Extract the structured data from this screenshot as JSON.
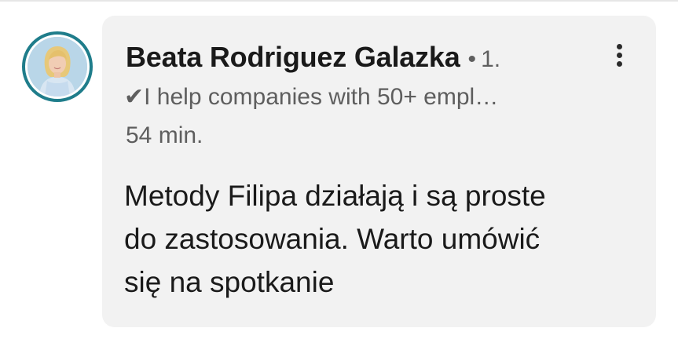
{
  "comment": {
    "author_name": "Beata Rodriguez Galazka",
    "separator": "•",
    "connection_degree": "1.",
    "headline": "✔I help companies with 50+ empl…",
    "timestamp": "54 min.",
    "body_lines": [
      "Metody Filipa działają i są proste",
      "do zastosowania. Warto umówić",
      "się na spotkanie"
    ]
  },
  "colors": {
    "avatar_ring": "#1f7d8b",
    "bubble_background": "#f2f2f2",
    "primary_text": "#1a1a1a",
    "secondary_text": "#5e5e5e"
  },
  "icons": {
    "more_options": "vertical-ellipsis-icon"
  }
}
